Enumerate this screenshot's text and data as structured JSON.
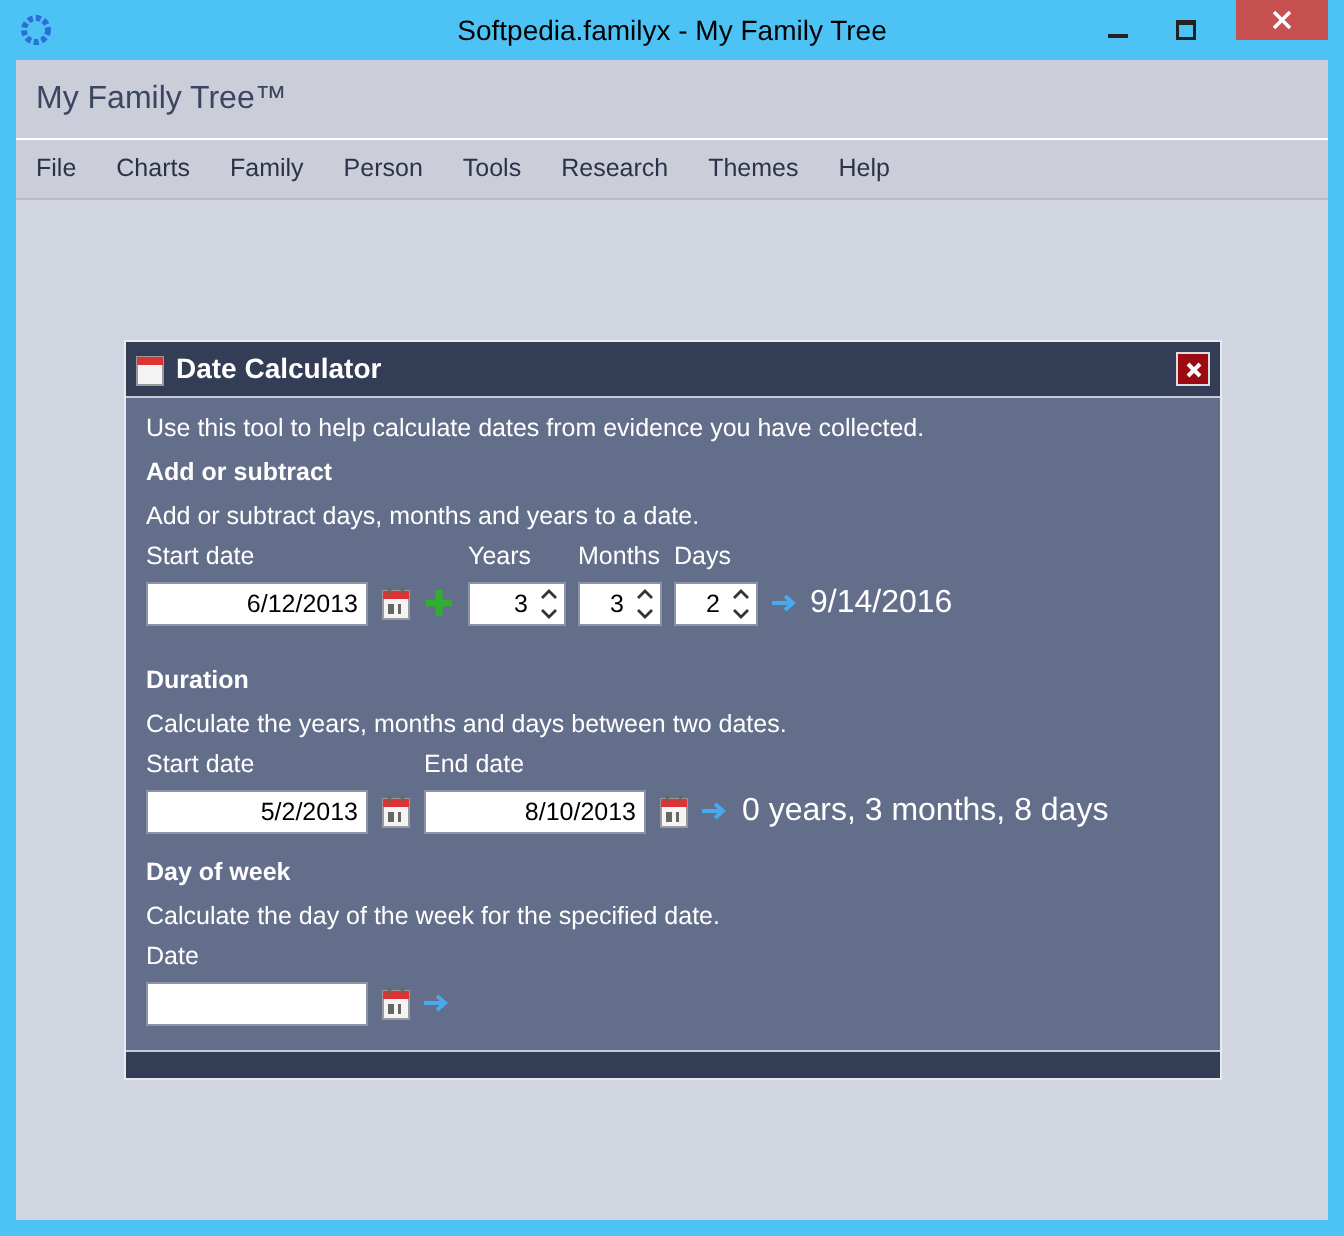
{
  "window": {
    "title": "Softpedia.familyx - My Family Tree"
  },
  "app_title": "My Family Tree™",
  "menu": [
    {
      "label": "File"
    },
    {
      "label": "Charts"
    },
    {
      "label": "Family"
    },
    {
      "label": "Person"
    },
    {
      "label": "Tools"
    },
    {
      "label": "Research"
    },
    {
      "label": "Themes"
    },
    {
      "label": "Help"
    }
  ],
  "dialog": {
    "title": "Date Calculator",
    "intro": "Use this tool to help calculate dates from evidence you have collected.",
    "sections": [
      {
        "kind": "add",
        "heading": "Add or subtract",
        "description": "Add or subtract days, months and years to a date.",
        "dates": [
          {
            "label": "Start date",
            "value": "6/12/2013"
          }
        ],
        "spinners": [
          {
            "label": "Years",
            "value": "3"
          },
          {
            "label": "Months",
            "value": "3"
          },
          {
            "label": "Days",
            "value": "2"
          }
        ],
        "result": "9/14/2016"
      },
      {
        "kind": "duration",
        "heading": "Duration",
        "description": "Calculate the years, months and days between two dates.",
        "dates": [
          {
            "label": "Start date",
            "value": "5/2/2013"
          },
          {
            "label": "End date",
            "value": "8/10/2013"
          }
        ],
        "result": "0 years, 3 months, 8 days"
      },
      {
        "kind": "weekday",
        "heading": "Day of week",
        "description": "Calculate the day of the week for the specified date.",
        "dates": [
          {
            "label": "Date"
          }
        ]
      }
    ]
  }
}
